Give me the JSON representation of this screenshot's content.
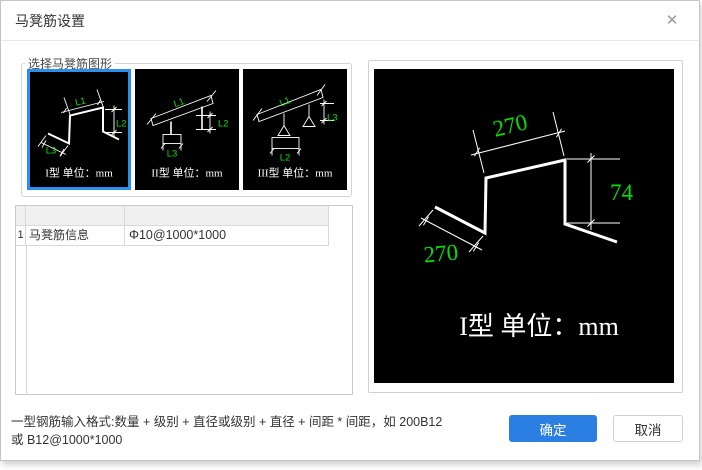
{
  "dialog": {
    "title": "马凳筋设置",
    "close_glyph": "✕"
  },
  "groupbox": {
    "legend": "选择马凳筋图形",
    "thumbnails": [
      {
        "caption": "I型 单位：mm",
        "l1": "L1",
        "l2": "L2",
        "l3": "L3",
        "selected": true
      },
      {
        "caption": "II型 单位：mm",
        "l1": "L1",
        "l2": "L2",
        "l3": "L3",
        "selected": false
      },
      {
        "caption": "III型 单位：mm",
        "l1": "L1",
        "l2": "L2",
        "l3": "L3",
        "selected": false
      }
    ]
  },
  "table": {
    "rows": [
      {
        "index": "1",
        "name": "马凳筋信息",
        "value": "Φ10@1000*1000"
      }
    ]
  },
  "preview": {
    "dim_top": "270",
    "dim_right": "74",
    "dim_bottom_left": "270",
    "caption": "I型 单位：mm"
  },
  "footer": {
    "note_line1": "一型钢筋输入格式:数量 + 级别 + 直径或级别 + 直径 + 间距 * 间距，如 200B12",
    "note_line2": "或 B12@1000*1000",
    "ok_label": "确定",
    "cancel_label": "取消"
  },
  "colors": {
    "accent_blue": "#2b7fe3",
    "selection_blue": "#2b8ff2",
    "cad_green": "#00e100",
    "cad_line": "#ffffff",
    "canvas_bg": "#000000"
  }
}
